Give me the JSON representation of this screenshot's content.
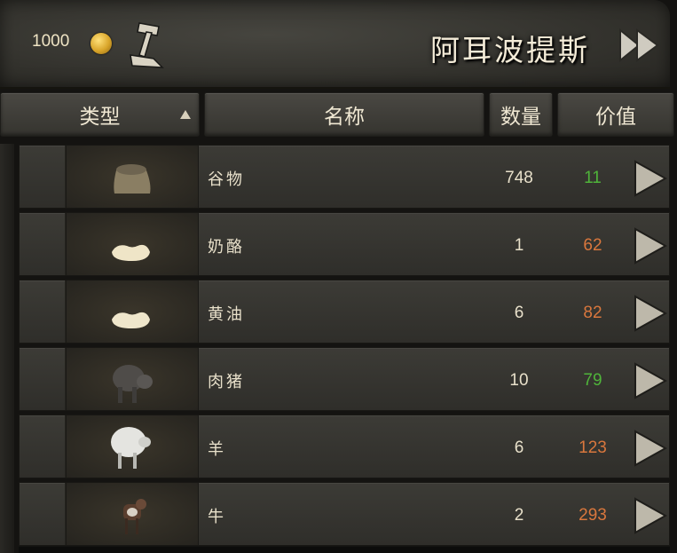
{
  "header": {
    "gold": "1000",
    "town_name": "阿耳波提斯",
    "gold_icon": "coin-icon",
    "action_icon": "hammer-icon",
    "skip_icon": "double-arrow-icon"
  },
  "columns": {
    "type": "类型",
    "name": "名称",
    "quantity": "数量",
    "value": "价值"
  },
  "colors": {
    "price_good": "#4fb43a",
    "price_bad": "#d9773d"
  },
  "items": [
    {
      "name": "谷物",
      "quantity": "748",
      "price": "11",
      "price_color": "#4fb43a",
      "icon": "grain-sack-icon"
    },
    {
      "name": "奶酪",
      "quantity": "1",
      "price": "62",
      "price_color": "#d9773d",
      "icon": "cheese-icon"
    },
    {
      "name": "黄油",
      "quantity": "6",
      "price": "82",
      "price_color": "#d9773d",
      "icon": "butter-icon"
    },
    {
      "name": "肉猪",
      "quantity": "10",
      "price": "79",
      "price_color": "#4fb43a",
      "icon": "hog-icon"
    },
    {
      "name": "羊",
      "quantity": "6",
      "price": "123",
      "price_color": "#d9773d",
      "icon": "sheep-icon"
    },
    {
      "name": "牛",
      "quantity": "2",
      "price": "293",
      "price_color": "#d9773d",
      "icon": "cow-icon"
    }
  ]
}
